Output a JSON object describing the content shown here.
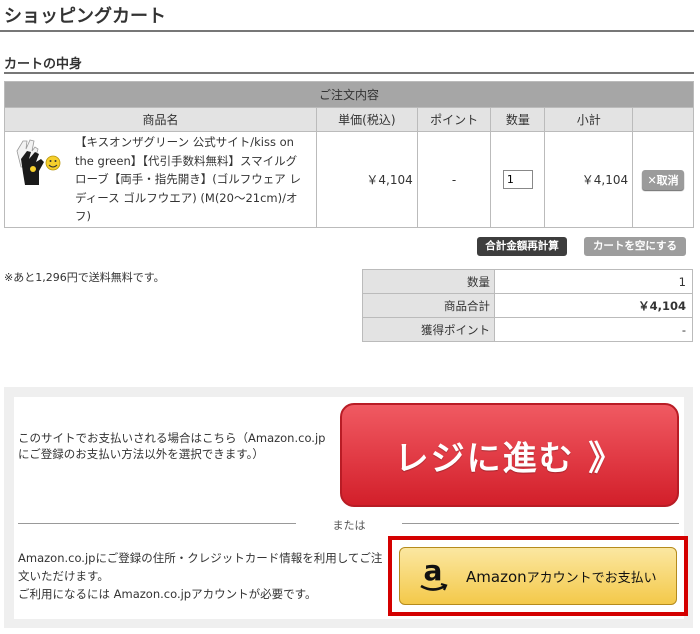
{
  "page": {
    "title": "ショッピングカート",
    "section_title": "カートの中身"
  },
  "cart": {
    "caption": "ご注文内容",
    "headers": {
      "product": "商品名",
      "unit_price": "単価(税込)",
      "points": "ポイント",
      "quantity": "数量",
      "subtotal": "小計"
    },
    "items": [
      {
        "name": "【キスオンザグリーン 公式サイト/kiss on the green】【代引手数料無料】スマイルグローブ【両手・指先開き】(ゴルフウェア レディース ゴルフウエア) (M(20～21cm)/オフ)",
        "unit_price": "￥4,104",
        "points": "-",
        "quantity": "1",
        "subtotal": "￥4,104",
        "cancel_label": "✕取消"
      }
    ]
  },
  "actions": {
    "recalculate": "合計金額再計算",
    "empty_cart": "カートを空にする"
  },
  "shipping_note": "※あと1,296円で送料無料です。",
  "summary": {
    "rows": [
      {
        "label": "数量",
        "value": "1"
      },
      {
        "label": "商品合計",
        "value": "￥4,104"
      },
      {
        "label": "獲得ポイント",
        "value": "-"
      }
    ]
  },
  "payment": {
    "site_text": "このサイトでお支払いされる場合はこちら（Amazon.co.jpにご登録のお支払い方法以外を選択できます。）",
    "regi_button": "レジに進む 》",
    "or_text": "または",
    "amazon_text_1": "Amazon.co.jpにご登録の住所・クレジットカード情報を利用してご注文いただけます。",
    "amazon_text_2": "ご利用になるには Amazon.co.jpアカウントが必要です。",
    "amazon_button_brand": "Amazon",
    "amazon_button_suffix": "アカウントでお支払い",
    "amazon_logo_letter": "a"
  },
  "colors": {
    "regi_red": "#e23c46",
    "amazon_gold": "#f4c94a",
    "highlight_frame": "#d40000"
  }
}
